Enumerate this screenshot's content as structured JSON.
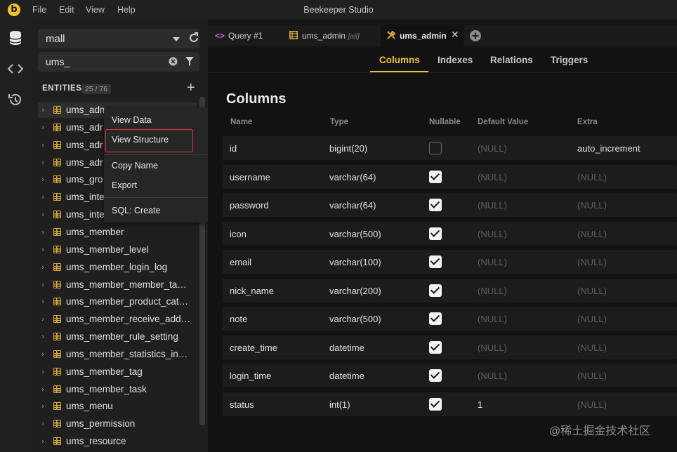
{
  "app": {
    "title": "Beekeeper Studio",
    "logo_letter": "b",
    "menu": [
      "File",
      "Edit",
      "View",
      "Help"
    ]
  },
  "sidebar": {
    "database": "mall",
    "filter_value": "ums_",
    "entities_label": "ENTITIES",
    "entities_count": "25 / 76",
    "entities": [
      "ums_adm",
      "ums_adr",
      "ums_adr",
      "ums_adr",
      "ums_gro",
      "ums_inte",
      "ums_inte",
      "ums_member",
      "ums_member_level",
      "ums_member_login_log",
      "ums_member_member_ta…",
      "ums_member_product_cat…",
      "ums_member_receive_add…",
      "ums_member_rule_setting",
      "ums_member_statistics_in…",
      "ums_member_tag",
      "ums_member_task",
      "ums_menu",
      "ums_permission",
      "ums_resource"
    ]
  },
  "context_menu": {
    "items": [
      "View Data",
      "View Structure",
      "Copy Name",
      "Export",
      "SQL: Create"
    ],
    "highlighted": "View Structure"
  },
  "tabs": [
    {
      "label": "Query #1",
      "icon": "code-icon"
    },
    {
      "label": "ums_admin",
      "sub": "[all]",
      "icon": "table-icon"
    },
    {
      "label": "ums_admin",
      "icon": "tools-icon",
      "active": true
    }
  ],
  "subtabs": [
    "Columns",
    "Indexes",
    "Relations",
    "Triggers"
  ],
  "active_subtab": "Columns",
  "structure": {
    "heading": "Columns",
    "headers": [
      "Name",
      "Type",
      "Nullable",
      "Default Value",
      "Extra"
    ],
    "rows": [
      {
        "name": "id",
        "type": "bigint(20)",
        "nullable": false,
        "default": "(NULL)",
        "extra": "auto_increment"
      },
      {
        "name": "username",
        "type": "varchar(64)",
        "nullable": true,
        "default": "(NULL)",
        "extra": "(NULL)"
      },
      {
        "name": "password",
        "type": "varchar(64)",
        "nullable": true,
        "default": "(NULL)",
        "extra": "(NULL)"
      },
      {
        "name": "icon",
        "type": "varchar(500)",
        "nullable": true,
        "default": "(NULL)",
        "extra": "(NULL)"
      },
      {
        "name": "email",
        "type": "varchar(100)",
        "nullable": true,
        "default": "(NULL)",
        "extra": "(NULL)"
      },
      {
        "name": "nick_name",
        "type": "varchar(200)",
        "nullable": true,
        "default": "(NULL)",
        "extra": "(NULL)"
      },
      {
        "name": "note",
        "type": "varchar(500)",
        "nullable": true,
        "default": "(NULL)",
        "extra": "(NULL)"
      },
      {
        "name": "create_time",
        "type": "datetime",
        "nullable": true,
        "default": "(NULL)",
        "extra": "(NULL)"
      },
      {
        "name": "login_time",
        "type": "datetime",
        "nullable": true,
        "default": "(NULL)",
        "extra": "(NULL)"
      },
      {
        "name": "status",
        "type": "int(1)",
        "nullable": true,
        "default": "1",
        "extra": "(NULL)"
      }
    ]
  },
  "watermark": "@稀土掘金技术社区",
  "colors": {
    "accent": "#f2c230",
    "highlight_border": "#e0313e",
    "table_icon": "#d8a83a",
    "background": "#121212"
  }
}
